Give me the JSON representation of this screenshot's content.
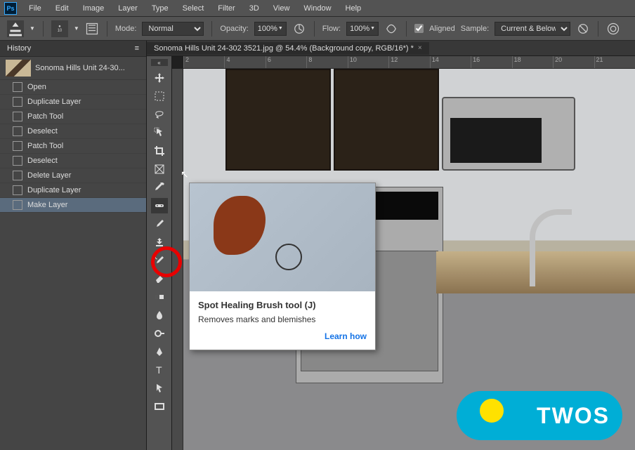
{
  "menubar": [
    "File",
    "Edit",
    "Image",
    "Layer",
    "Type",
    "Select",
    "Filter",
    "3D",
    "View",
    "Window",
    "Help"
  ],
  "ps_label": "Ps",
  "optbar": {
    "brush_size": "10",
    "mode_label": "Mode:",
    "mode_value": "Normal",
    "opacity_label": "Opacity:",
    "opacity_value": "100%",
    "flow_label": "Flow:",
    "flow_value": "100%",
    "aligned_label": "Aligned",
    "sample_label": "Sample:",
    "sample_value": "Current & Below"
  },
  "history": {
    "title": "History",
    "thumb_name": "Sonoma Hills Unit 24-30...",
    "items": [
      "Open",
      "Duplicate Layer",
      "Patch Tool",
      "Deselect",
      "Patch Tool",
      "Deselect",
      "Delete Layer",
      "Duplicate Layer",
      "Make Layer"
    ]
  },
  "tab": {
    "title": "Sonoma Hills Unit 24-302 3521.jpg @ 54.4% (Background copy, RGB/16*) *"
  },
  "ruler_marks": [
    "2",
    "4",
    "6",
    "8",
    "10",
    "12",
    "14",
    "16",
    "18",
    "20",
    "21"
  ],
  "tooltip": {
    "title": "Spot Healing Brush tool (J)",
    "desc": "Removes marks and blemishes",
    "link": "Learn how"
  },
  "badge": {
    "text": "TWOS"
  }
}
